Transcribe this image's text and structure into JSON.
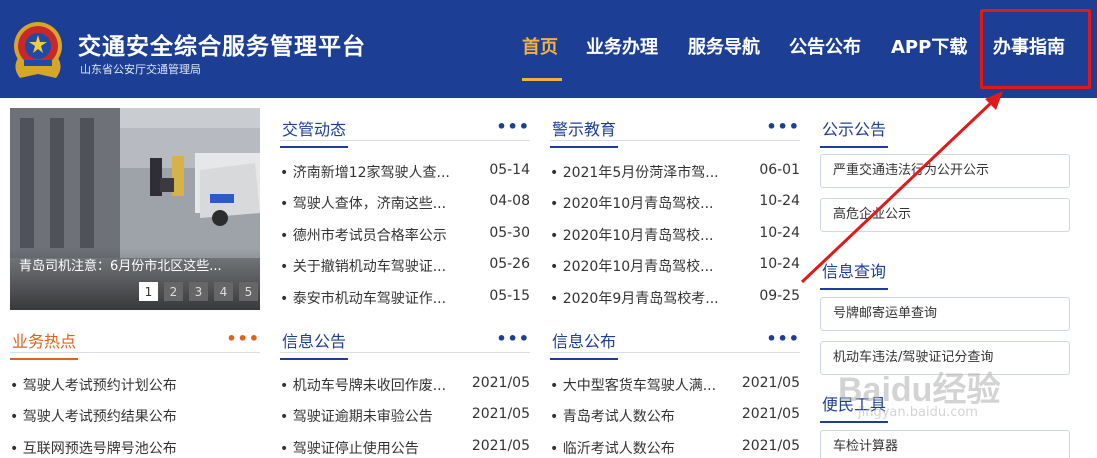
{
  "header": {
    "title": "交通安全综合服务管理平台",
    "subtitle": "山东省公安厅交通管理局",
    "nav": [
      "首页",
      "业务办理",
      "服务导航",
      "公告公布",
      "APP下载",
      "办事指南"
    ],
    "active_index": 0,
    "colors": {
      "bar": "#1c3f95",
      "active": "#f0b043",
      "highlight": "#e01a1a"
    }
  },
  "carousel": {
    "caption": "青岛司机注意：6月份市北区这些...",
    "pages": [
      "1",
      "2",
      "3",
      "4",
      "5"
    ],
    "active_page": 1
  },
  "sections": {
    "traffic_news": {
      "title": "交管动态",
      "more": "•••",
      "items": [
        {
          "title": "• 济南新增12家驾驶人查...",
          "date": "05-14"
        },
        {
          "title": "• 驾驶人查体，济南这些...",
          "date": "04-08"
        },
        {
          "title": "• 德州市考试员合格率公示",
          "date": "05-30"
        },
        {
          "title": "• 关于撤销机动车驾驶证...",
          "date": "05-26"
        },
        {
          "title": "• 泰安市机动车驾驶证作...",
          "date": "05-15"
        }
      ]
    },
    "warning_edu": {
      "title": "警示教育",
      "more": "•••",
      "items": [
        {
          "title": "• 2021年5月份菏泽市驾...",
          "date": "06-01"
        },
        {
          "title": "• 2020年10月青岛驾校...",
          "date": "10-24"
        },
        {
          "title": "• 2020年10月青岛驾校...",
          "date": "10-24"
        },
        {
          "title": "• 2020年10月青岛驾校...",
          "date": "10-24"
        },
        {
          "title": "• 2020年9月青岛驾校考...",
          "date": "09-25"
        }
      ]
    },
    "public_notice": {
      "title": "公示公告",
      "buttons": [
        "严重交通违法行为公开公示",
        "高危企业公示"
      ]
    },
    "hot_business": {
      "title": "业务热点",
      "more": "•••",
      "items": [
        {
          "title": "• 驾驶人考试预约计划公布"
        },
        {
          "title": "• 驾驶人考试预约结果公布"
        },
        {
          "title": "• 互联网预选号牌号池公布"
        }
      ]
    },
    "info_notice": {
      "title": "信息公告",
      "more": "•••",
      "items": [
        {
          "title": "• 机动车号牌未收回作废...",
          "date": "2021/05"
        },
        {
          "title": "• 驾驶证逾期未审验公告",
          "date": "2021/05"
        },
        {
          "title": "• 驾驶证停止使用公告",
          "date": "2021/05"
        }
      ]
    },
    "info_publish": {
      "title": "信息公布",
      "more": "•••",
      "items": [
        {
          "title": "• 大中型客货车驾驶人满...",
          "date": "2021/05"
        },
        {
          "title": "• 青岛考试人数公布",
          "date": "2021/05"
        },
        {
          "title": "• 临沂考试人数公布",
          "date": "2021/05"
        }
      ]
    },
    "info_query": {
      "title": "信息查询",
      "buttons": [
        "号牌邮寄运单查询",
        "机动车违法/驾驶证记分查询"
      ]
    },
    "convenience": {
      "title": "便民工具",
      "buttons": [
        "车检计算器"
      ]
    }
  },
  "watermark": {
    "logo": "Baidu经验",
    "url": "jingyan.baidu.com"
  }
}
